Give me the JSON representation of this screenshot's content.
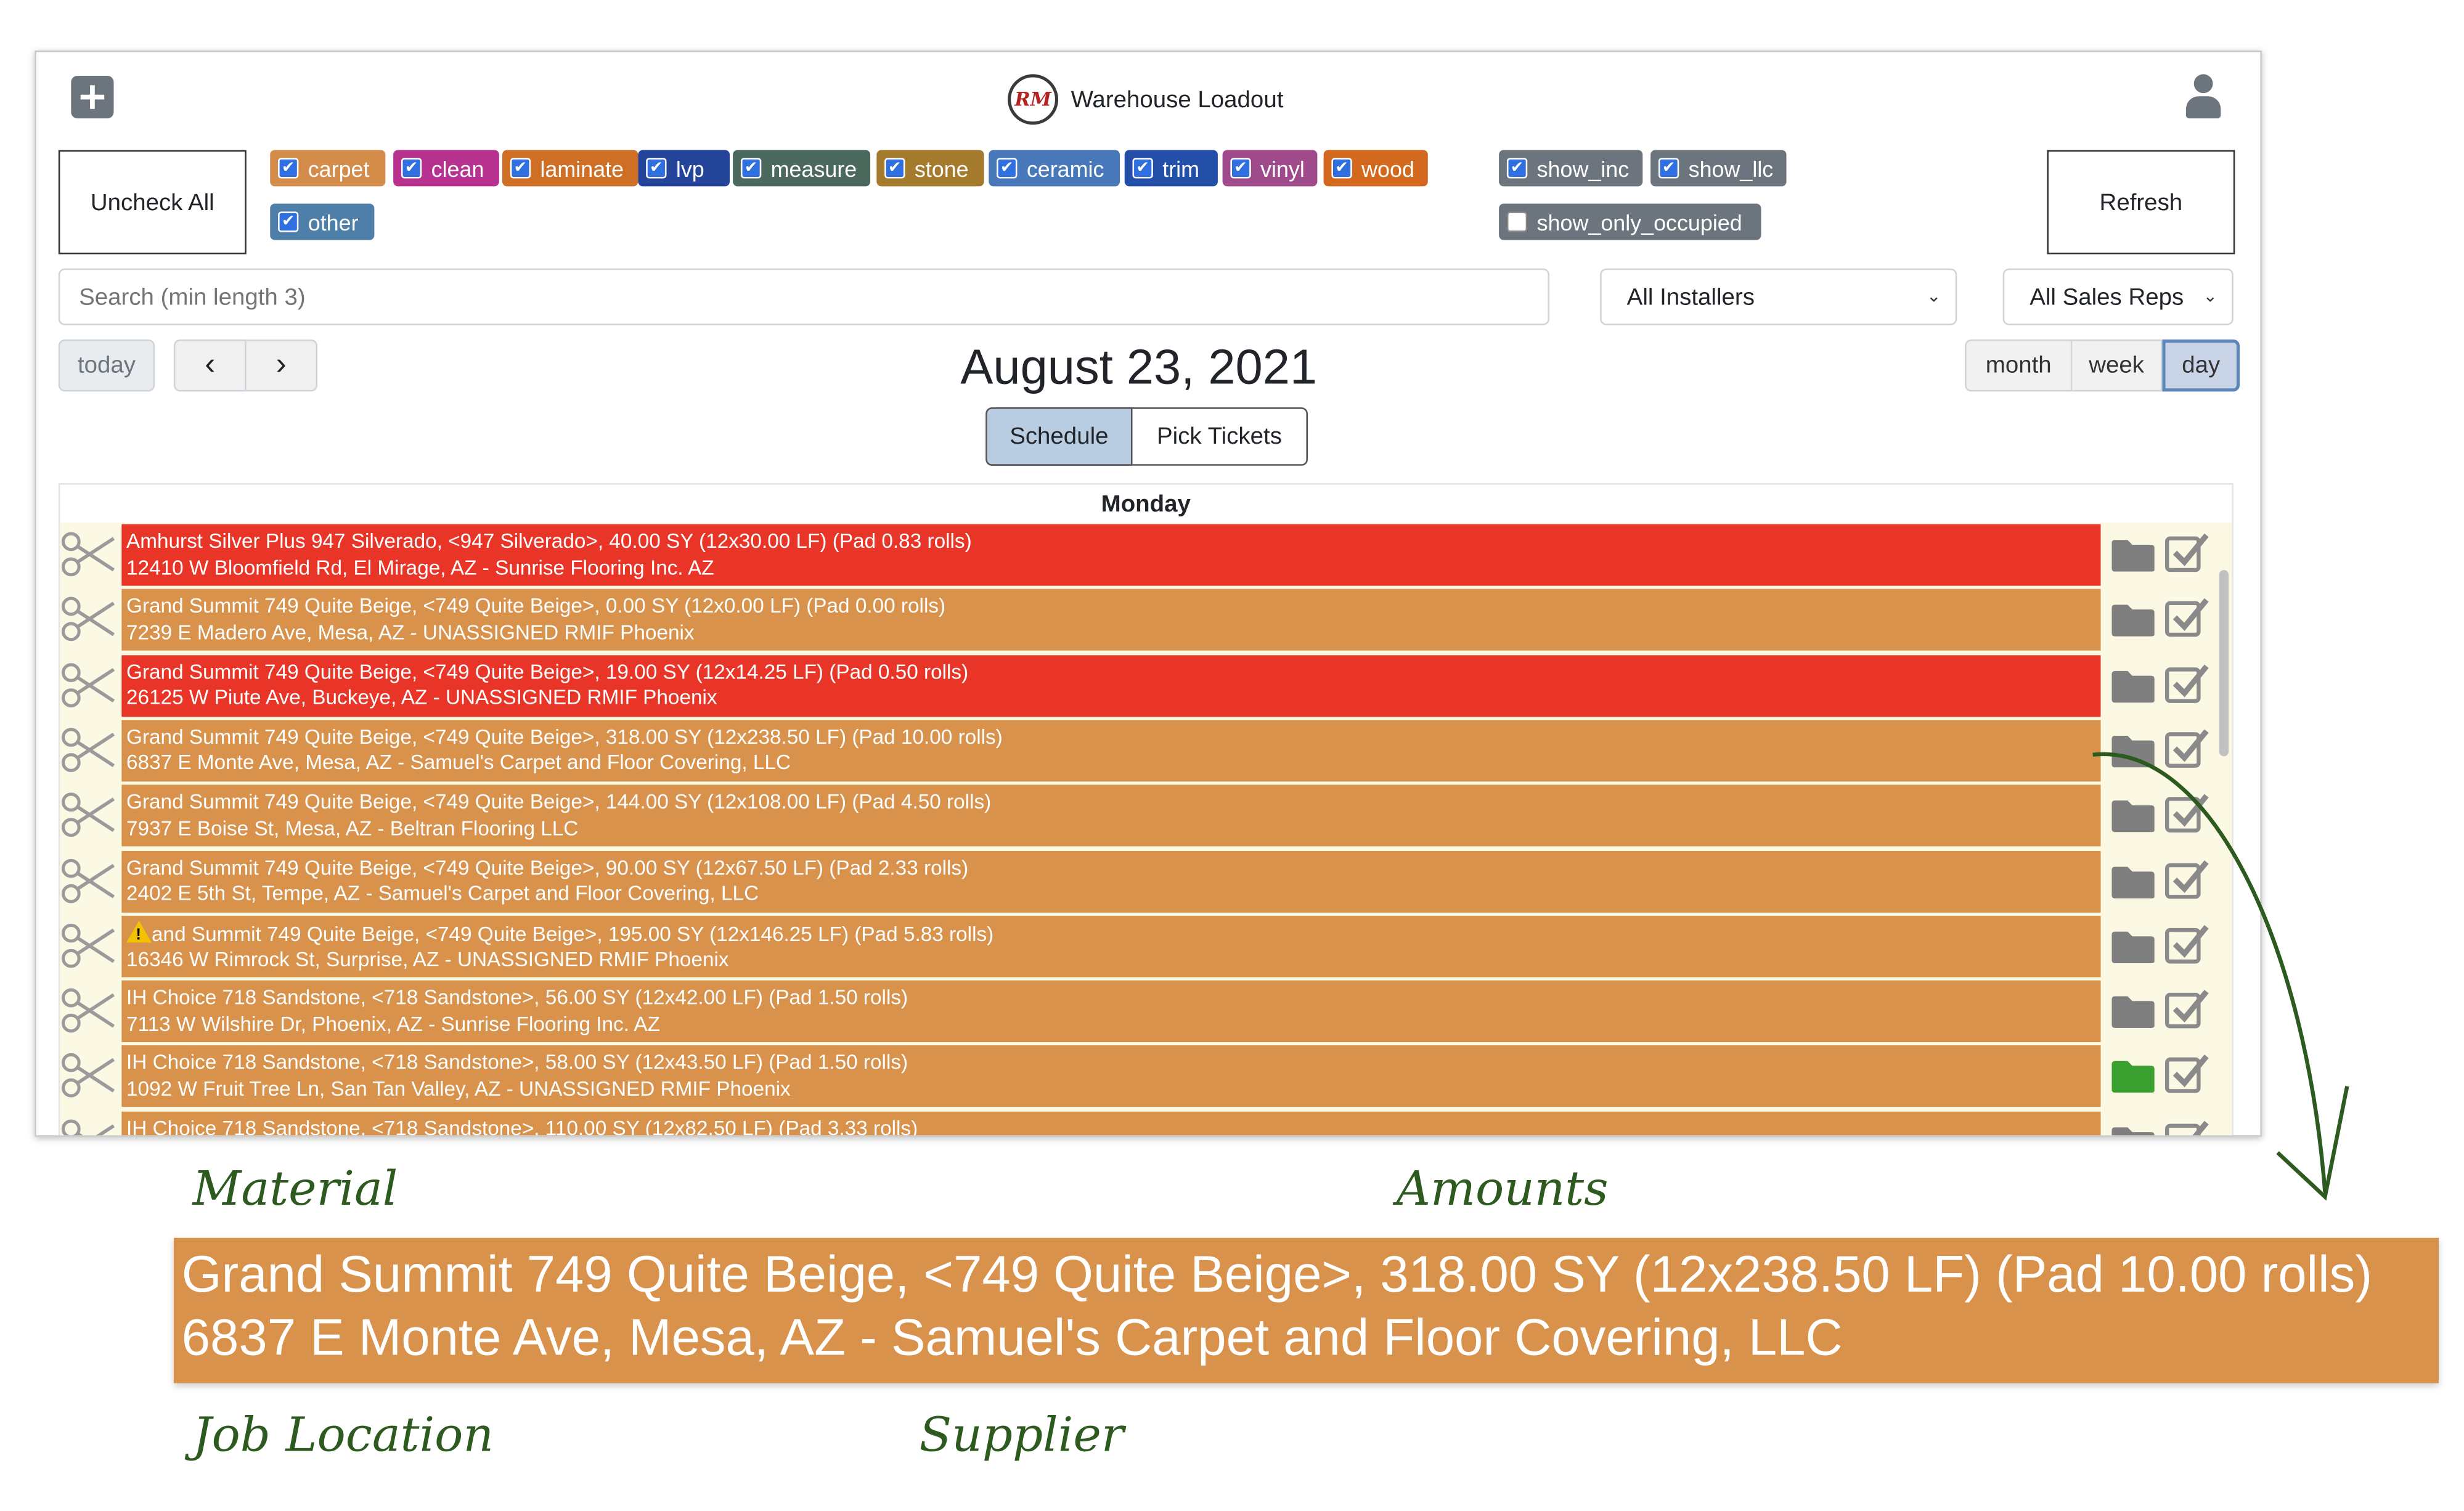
{
  "app": {
    "logo_text": "RM",
    "title": "Warehouse Loadout"
  },
  "toolbar": {
    "uncheck_all": "Uncheck All",
    "refresh": "Refresh"
  },
  "filters": [
    {
      "label": "carpet",
      "checked": true,
      "color": "#d48c4a"
    },
    {
      "label": "clean",
      "checked": true,
      "color": "#b7328f"
    },
    {
      "label": "laminate",
      "checked": true,
      "color": "#cf6f26"
    },
    {
      "label": "lvp",
      "checked": true,
      "color": "#24449a"
    },
    {
      "label": "measure",
      "checked": true,
      "color": "#4b6a5d"
    },
    {
      "label": "stone",
      "checked": true,
      "color": "#a47b2c"
    },
    {
      "label": "ceramic",
      "checked": true,
      "color": "#4878ba"
    },
    {
      "label": "trim",
      "checked": true,
      "color": "#234fa8"
    },
    {
      "label": "vinyl",
      "checked": true,
      "color": "#9e4a8b"
    },
    {
      "label": "wood",
      "checked": true,
      "color": "#d2691e"
    },
    {
      "label": "other",
      "checked": true,
      "color": "#4e7fa8"
    }
  ],
  "options": [
    {
      "label": "show_inc",
      "checked": true,
      "color": "#6c757d"
    },
    {
      "label": "show_llc",
      "checked": true,
      "color": "#6c757d"
    },
    {
      "label": "show_only_occupied",
      "checked": false,
      "color": "#6c757d"
    }
  ],
  "search": {
    "placeholder": "Search (min length 3)"
  },
  "installers_select": {
    "value": "All Installers"
  },
  "sales_reps_select": {
    "value": "All Sales Reps"
  },
  "nav": {
    "today": "today",
    "prev": "‹",
    "next": "›",
    "date_title": "August 23, 2021",
    "views": {
      "month": "month",
      "week": "week",
      "day": "day",
      "active": "day"
    },
    "tabs": {
      "schedule": "Schedule",
      "pick_tickets": "Pick Tickets",
      "active": "schedule"
    }
  },
  "calendar": {
    "day_header": "Monday",
    "events": [
      {
        "line1": "Amhurst Silver Plus 947 Silverado, <947 Silverado>, 40.00 SY (12x30.00 LF) (Pad 0.83 rolls)",
        "line2": "12410 W Bloomfield Rd, El Mirage, AZ - Sunrise Flooring Inc. AZ",
        "color": "#e93527",
        "folder_color": "#7f7f7f",
        "warning": false
      },
      {
        "line1": "Grand Summit 749 Quite Beige, <749 Quite Beige>, 0.00 SY (12x0.00 LF) (Pad 0.00 rolls)",
        "line2": "7239 E Madero Ave, Mesa, AZ - UNASSIGNED RMIF Phoenix",
        "color": "#d8924b",
        "folder_color": "#7f7f7f",
        "warning": false
      },
      {
        "line1": "Grand Summit 749 Quite Beige, <749 Quite Beige>, 19.00 SY (12x14.25 LF) (Pad 0.50 rolls)",
        "line2": "26125 W Piute Ave, Buckeye, AZ - UNASSIGNED RMIF Phoenix",
        "color": "#e93527",
        "folder_color": "#7f7f7f",
        "warning": false
      },
      {
        "line1": "Grand Summit 749 Quite Beige, <749 Quite Beige>, 318.00 SY (12x238.50 LF) (Pad 10.00 rolls)",
        "line2": "6837 E Monte Ave, Mesa, AZ - Samuel's Carpet and Floor Covering, LLC",
        "color": "#d8924b",
        "folder_color": "#7f7f7f",
        "warning": false
      },
      {
        "line1": "Grand Summit 749 Quite Beige, <749 Quite Beige>, 144.00 SY (12x108.00 LF) (Pad 4.50 rolls)",
        "line2": "7937 E Boise St, Mesa, AZ - Beltran Flooring LLC",
        "color": "#d8924b",
        "folder_color": "#7f7f7f",
        "warning": false
      },
      {
        "line1": "Grand Summit 749 Quite Beige, <749 Quite Beige>, 90.00 SY (12x67.50 LF) (Pad 2.33 rolls)",
        "line2": "2402 E 5th St, Tempe, AZ - Samuel's Carpet and Floor Covering, LLC",
        "color": "#d8924b",
        "folder_color": "#7f7f7f",
        "warning": false
      },
      {
        "line1": "and Summit 749 Quite Beige, <749 Quite Beige>, 195.00 SY (12x146.25 LF) (Pad 5.83 rolls)",
        "line2": "16346 W Rimrock St, Surprise, AZ - UNASSIGNED RMIF Phoenix",
        "color": "#d8924b",
        "folder_color": "#7f7f7f",
        "warning": true
      },
      {
        "line1": "IH Choice 718 Sandstone, <718 Sandstone>, 56.00 SY (12x42.00 LF) (Pad 1.50 rolls)",
        "line2": "7113 W Wilshire Dr, Phoenix, AZ - Sunrise Flooring Inc. AZ",
        "color": "#d8924b",
        "folder_color": "#7f7f7f",
        "warning": false
      },
      {
        "line1": "IH Choice 718 Sandstone, <718 Sandstone>, 58.00 SY (12x43.50 LF) (Pad 1.50 rolls)",
        "line2": "1092 W Fruit Tree Ln, San Tan Valley, AZ - UNASSIGNED RMIF Phoenix",
        "color": "#d8924b",
        "folder_color": "#3aa131",
        "warning": false
      },
      {
        "line1": "IH Choice 718 Sandstone, <718 Sandstone>, 110.00 SY (12x82.50 LF) (Pad 3.33 rolls)",
        "line2": "",
        "color": "#d8924b",
        "folder_color": "#7f7f7f",
        "warning": false
      }
    ]
  },
  "annotation": {
    "labels": {
      "material": "Material",
      "amounts": "Amounts",
      "job_location": "Job Location",
      "supplier": "Supplier"
    },
    "zoom_line1": "Grand Summit 749 Quite Beige, <749 Quite Beige>, 318.00 SY (12x238.50 LF) (Pad 10.00 rolls)",
    "zoom_line2": "6837 E Monte Ave, Mesa, AZ - Samuel's Carpet and Floor Covering, LLC",
    "color": "#2c5a1f"
  }
}
